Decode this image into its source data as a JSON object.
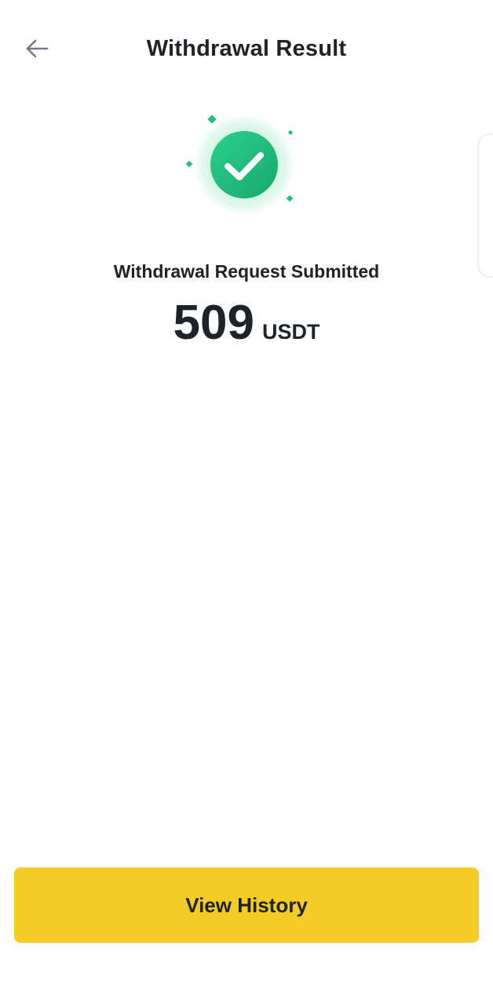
{
  "header": {
    "back_icon": "arrow-left-icon",
    "title": "Withdrawal Result"
  },
  "result": {
    "icon": "check-circle-icon",
    "status": "Withdrawal Request Submitted",
    "amount": "509",
    "unit": "USDT"
  },
  "actions": {
    "view_history_label": "View History"
  },
  "colors": {
    "success_green": "#1fbf7f",
    "button_yellow": "#f5cc26",
    "text_dark": "#1e2329",
    "icon_gray": "#707a8a"
  }
}
